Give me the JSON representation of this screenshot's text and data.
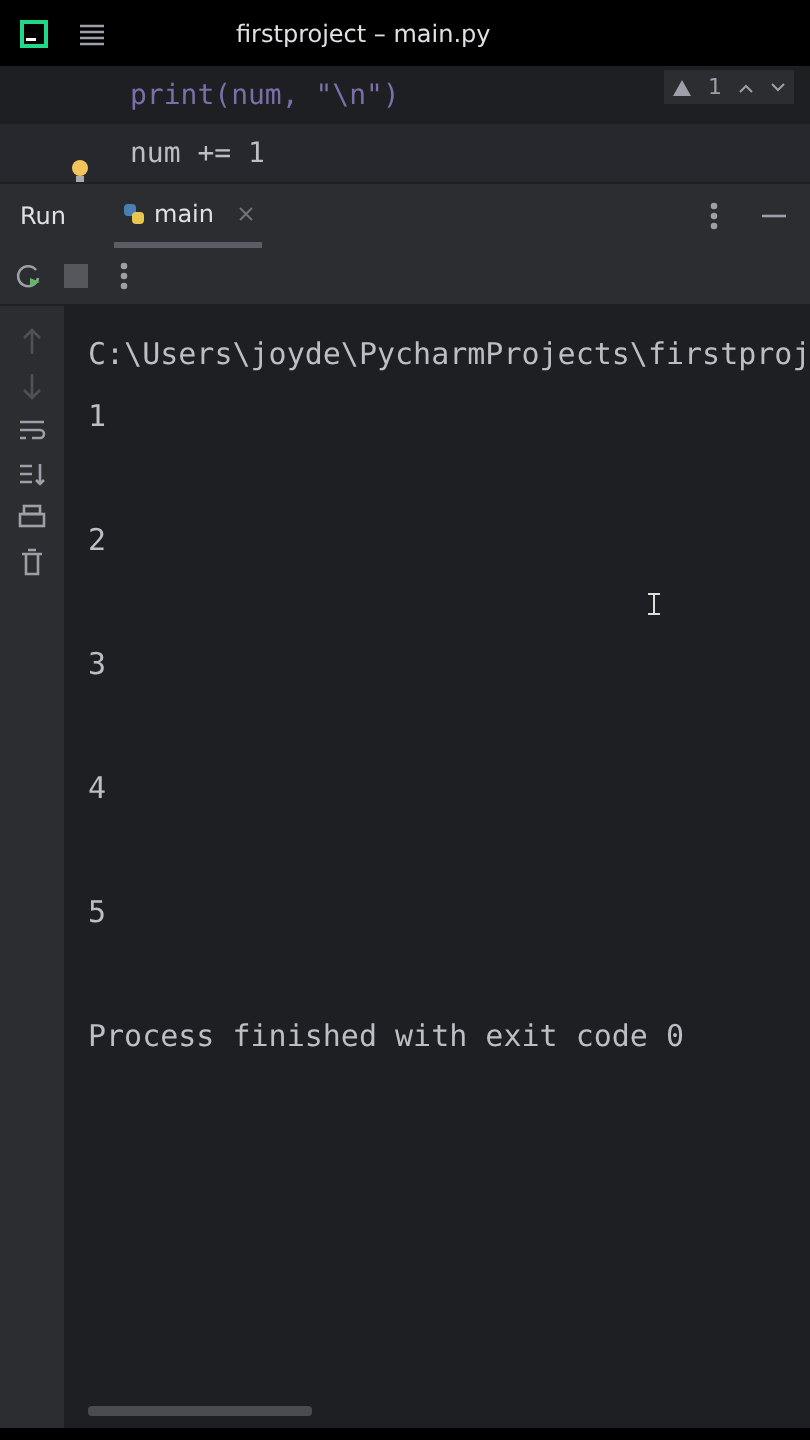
{
  "window": {
    "title": "firstproject – main.py"
  },
  "editor": {
    "lines": [
      {
        "text": "print(num, \"\\n\")",
        "kind": "call"
      },
      {
        "text": "num += 1",
        "kind": "current"
      }
    ],
    "warnings": "1"
  },
  "run_panel": {
    "title": "Run",
    "tabs": [
      {
        "label": "main",
        "selected": true
      }
    ]
  },
  "console": {
    "lines": [
      {
        "text": "C:\\Users\\joyde\\PycharmProjects\\firstproj",
        "kind": "path"
      },
      {
        "text": "1",
        "kind": "output"
      },
      {
        "text": "2",
        "kind": "output"
      },
      {
        "text": "3",
        "kind": "output"
      },
      {
        "text": "4",
        "kind": "output"
      },
      {
        "text": "5",
        "kind": "output"
      },
      {
        "text": "Process finished with exit code 0",
        "kind": "status"
      }
    ]
  }
}
